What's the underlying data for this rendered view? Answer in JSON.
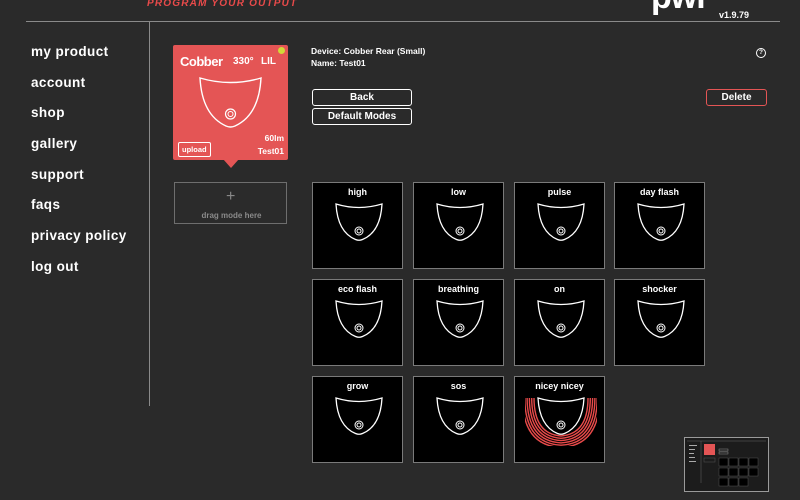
{
  "header": {
    "tagline": "PROGRAM YOUR OUTPUT",
    "logo": "pwr",
    "version": "v1.9.79"
  },
  "sidebar": {
    "items": [
      {
        "label": "my product"
      },
      {
        "label": "account"
      },
      {
        "label": "shop"
      },
      {
        "label": "gallery"
      },
      {
        "label": "support"
      },
      {
        "label": "faqs"
      },
      {
        "label": "privacy policy"
      },
      {
        "label": "log out"
      }
    ]
  },
  "device_card": {
    "brand": "Cobber",
    "model": "330°",
    "variant": "LIL",
    "upload_label": "upload",
    "lumens": "60lm",
    "name": "Test01",
    "status_color": "#d2d838",
    "card_color": "#e45555"
  },
  "dropzone": {
    "icon": "plus-icon",
    "label": "drag mode here"
  },
  "device_info": {
    "device_line": "Device: Cobber Rear (Small)",
    "name_line": "Name: Test01"
  },
  "buttons": {
    "back": "Back",
    "default_modes": "Default Modes",
    "delete": "Delete"
  },
  "help": {
    "icon": "help-icon",
    "glyph": "?"
  },
  "modes": [
    {
      "label": "high",
      "highlight": false
    },
    {
      "label": "low",
      "highlight": false
    },
    {
      "label": "pulse",
      "highlight": false
    },
    {
      "label": "day flash",
      "highlight": false
    },
    {
      "label": "eco flash",
      "highlight": false
    },
    {
      "label": "breathing",
      "highlight": false
    },
    {
      "label": "on",
      "highlight": false
    },
    {
      "label": "shocker",
      "highlight": false
    },
    {
      "label": "grow",
      "highlight": false
    },
    {
      "label": "sos",
      "highlight": false
    },
    {
      "label": "nicey nicey",
      "highlight": true
    }
  ],
  "colors": {
    "accent": "#e84a4a",
    "background": "#2a2a2a",
    "tile": "#000000"
  }
}
